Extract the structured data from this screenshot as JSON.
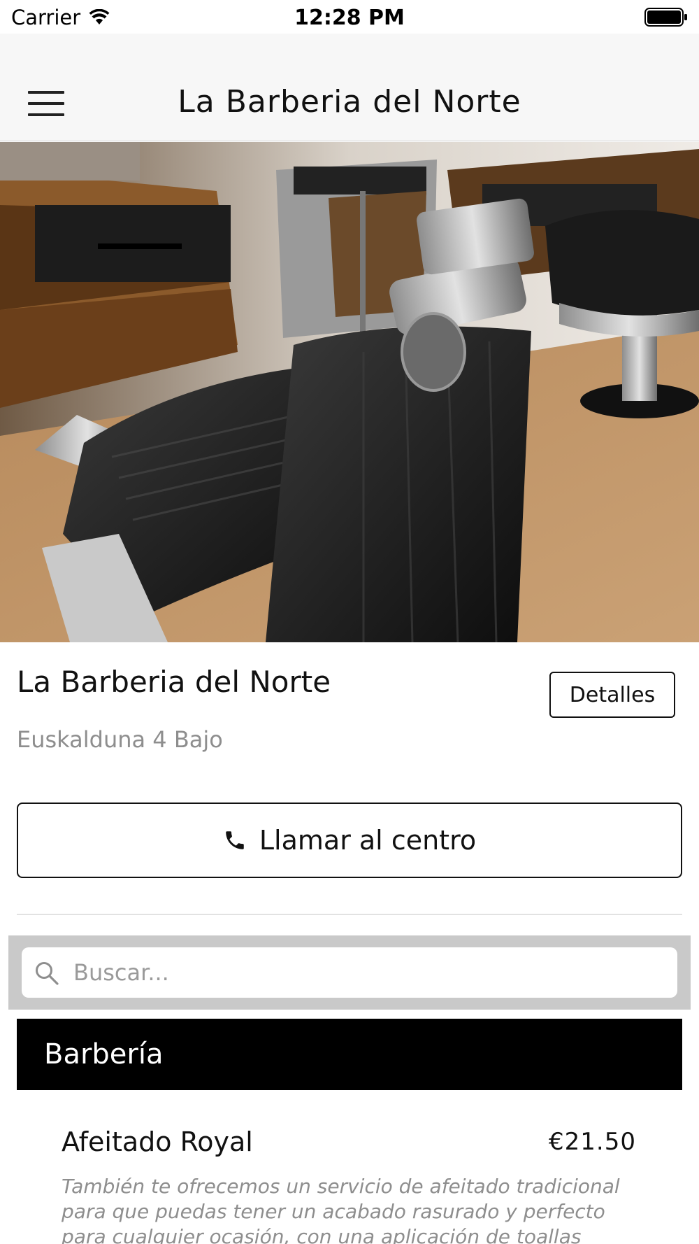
{
  "status_bar": {
    "carrier": "Carrier",
    "time": "12:28 PM",
    "wifi_icon": "wifi-icon",
    "battery_icon": "battery-icon"
  },
  "nav": {
    "title": "La Barberia del Norte",
    "menu_icon": "hamburger-menu-icon"
  },
  "hero": {
    "description": "barber-shop-photo"
  },
  "business": {
    "name": "La Barberia del Norte",
    "address": "Euskalduna 4 Bajo",
    "details_label": "Detalles",
    "call_label": "Llamar al centro",
    "call_icon": "phone-icon"
  },
  "search": {
    "placeholder": "Buscar...",
    "value": "",
    "icon": "search-icon"
  },
  "category": {
    "title": "Barbería"
  },
  "services": [
    {
      "title": "Afeitado Royal",
      "price": "€21.50",
      "description": "También te ofrecemos un servicio de afeitado tradicional para que puedas tener un acabado rasurado y perfecto para cualquier ocasión, con una aplicación de toallas calientes"
    }
  ],
  "colors": {
    "nav_background": "#f7f7f7",
    "category_background": "#000000",
    "search_bar_background": "#c9c9c9",
    "secondary_text": "#8e8e8e"
  }
}
